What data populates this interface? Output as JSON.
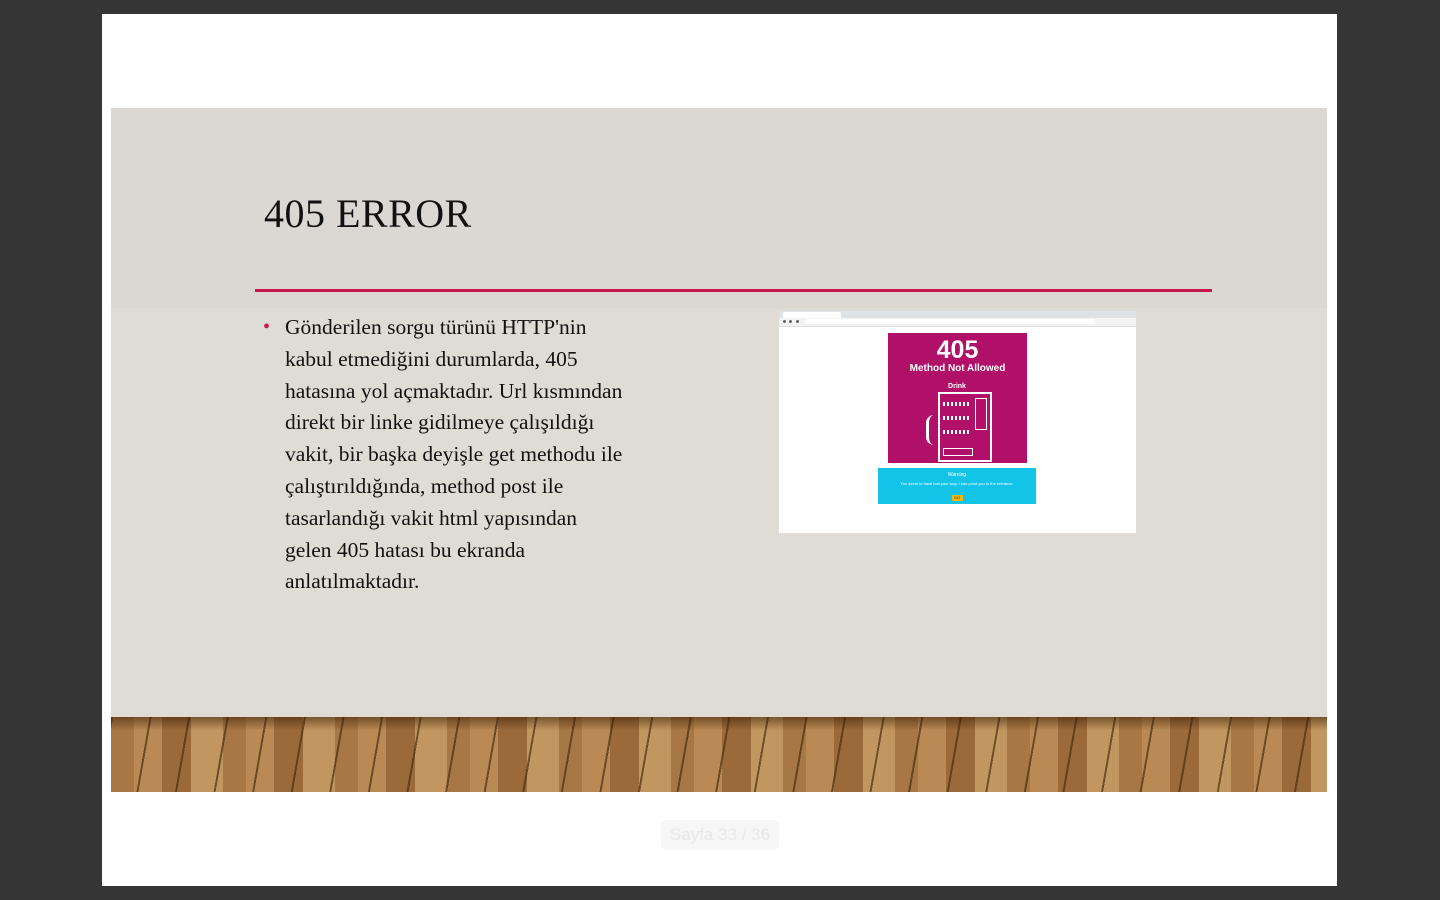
{
  "slide": {
    "title": "405 ERROR",
    "bullet": "Gönderilen sorgu türünü HTTP'nin kabul etmediğini durumlarda, 405 hatasına yol açmaktadır. Url kısmından direkt bir linke gidilmeye çalışıldığı vakit, bir başka deyişle get methodu ile çalıştırıldığında, method post ile tasarlandığı vakit html yapısından gelen 405 hatası bu ekranda anlatılmaktadır.",
    "accent_color": "#c8164e",
    "bullet_icon": "bullet-dot-icon"
  },
  "screenshot": {
    "code": "405",
    "message": "Method Not Allowed",
    "machine_label": "Drink",
    "warning_title": "Warning",
    "warning_text": "You seem to have lost your way. I can point you to the entrance.",
    "button_label": "GO",
    "card_color": "#b01067",
    "warning_color": "#14c4e8"
  },
  "viewer": {
    "page_indicator": "Sayfa 33 / 36"
  }
}
